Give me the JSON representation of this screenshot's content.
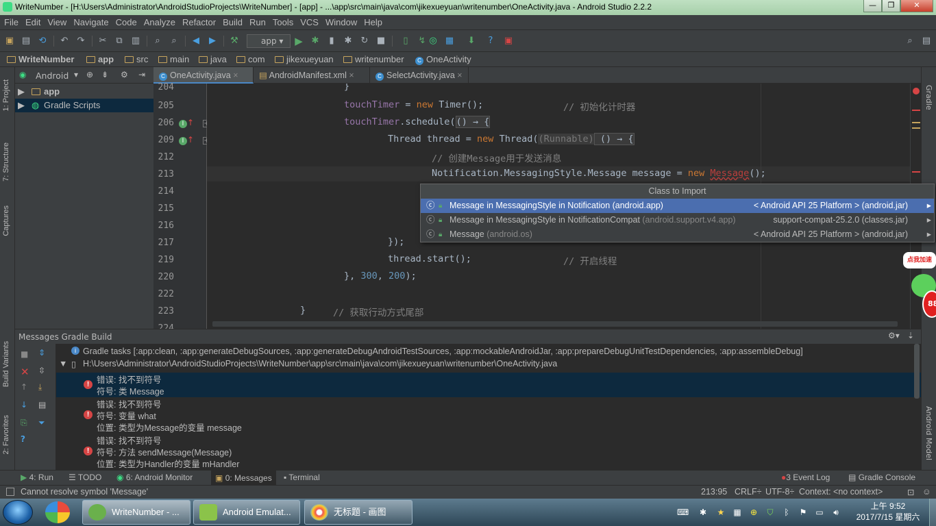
{
  "window": {
    "title": "WriteNumber - [H:\\Users\\Administrator\\AndroidStudioProjects\\WriteNumber] - [app] - ...\\app\\src\\main\\java\\com\\jikexueyuan\\writenumber\\OneActivity.java - Android Studio 2.2.2",
    "min": "—",
    "max": "❐",
    "close": "✕"
  },
  "menu": [
    "File",
    "Edit",
    "View",
    "Navigate",
    "Code",
    "Analyze",
    "Refactor",
    "Build",
    "Run",
    "Tools",
    "VCS",
    "Window",
    "Help"
  ],
  "toolbar": {
    "run_config": "app"
  },
  "breadcrumb": [
    "WriteNumber",
    "app",
    "src",
    "main",
    "java",
    "com",
    "jikexueyuan",
    "writenumber",
    "OneActivity"
  ],
  "left_tools": [
    "1: Project",
    "7: Structure",
    "Captures",
    "Build Variants",
    "2: Favorites"
  ],
  "right_tools": [
    "Gradle",
    "Android Model"
  ],
  "project_view": {
    "mode": "Android",
    "items": [
      {
        "label": "app",
        "selected": false
      },
      {
        "label": "Gradle Scripts",
        "selected": true
      }
    ]
  },
  "editor_tabs": [
    {
      "label": "OneActivity.java",
      "active": true
    },
    {
      "label": "AndroidManifest.xml",
      "active": false
    },
    {
      "label": "SelectActivity.java",
      "active": false
    }
  ],
  "line_numbers": [
    "204",
    "205",
    "206",
    "209",
    "212",
    "213",
    "214",
    "215",
    "216",
    "217",
    "219",
    "220",
    "222",
    "223",
    "224"
  ],
  "code": {
    "l205_a": "touchTimer",
    "l205_b": " = ",
    "l205_c": "new",
    "l205_d": " Timer();",
    "l205_cmt": "// 初始化计时器",
    "l206_a": "touchTimer",
    "l206_b": ".schedule(",
    "l206_c": "() → {",
    "l209_a": "Thread thread = ",
    "l209_b": "new",
    "l209_c": " Thread(",
    "l209_d": "(Runnable)",
    "l209_e": " () → {",
    "l212_cmt": "// 创建Message用于发送消息",
    "l213_a": "Notification.MessagingStyle.Message message = ",
    "l213_b": "new",
    "l213_c": "Message",
    "l213_d": "();",
    "l217": "});",
    "l219_a": "thread.start();",
    "l219_cmt": "// 开启线程",
    "l220_a": "}, ",
    "l220_b": "300",
    "l220_c": ", ",
    "l220_d": "200",
    "l220_e": ");",
    "l223_a": "}",
    "l223_cmt": "// 获取行动方式尾部"
  },
  "import_popup": {
    "title": "Class to Import",
    "items": [
      {
        "name": "Message in MessagingStyle in Notification (android.app)",
        "pkg": "",
        "loc": "< Android API 25 Platform > (android.jar)",
        "selected": true
      },
      {
        "name": "Message in MessagingStyle in NotificationCompat",
        "pkg": " (android.support.v4.app)",
        "loc": "support-compat-25.2.0 (classes.jar)",
        "selected": false
      },
      {
        "name": "Message",
        "pkg": " (android.os)",
        "loc": "< Android API 25 Platform > (android.jar)",
        "selected": false
      }
    ]
  },
  "messages": {
    "header": "Messages Gradle Build",
    "gradle_tasks": "Gradle tasks [:app:clean, :app:generateDebugSources, :app:generateDebugAndroidTestSources, :app:mockableAndroidJar, :app:prepareDebugUnitTestDependencies, :app:assembleDebug]",
    "file": "H:\\Users\\Administrator\\AndroidStudioProjects\\WriteNumber\\app\\src\\main\\java\\com\\jikexueyuan\\writenumber\\OneActivity.java",
    "errors": [
      {
        "l1": "错误: 找不到符号",
        "l2": "符号: 类 Message",
        "l3": ""
      },
      {
        "l1": "错误: 找不到符号",
        "l2": "符号:   变量 what",
        "l3": "位置: 类型为Message的变量 message"
      },
      {
        "l1": "错误: 找不到符号",
        "l2": "符号:   方法 sendMessage(Message)",
        "l3": "位置: 类型为Handler的变量 mHandler"
      }
    ]
  },
  "tool_tabs": {
    "run": "4: Run",
    "todo": "TODO",
    "monitor": "6: Android Monitor",
    "messages": "0: Messages",
    "terminal": "Terminal",
    "event_log": "3 Event Log",
    "gradle_console": "Gradle Console"
  },
  "status": {
    "message": "Cannot resolve symbol 'Message'",
    "position": "213:95",
    "line_sep": "CRLF÷",
    "encoding": "UTF-8÷",
    "context": "Context: <no context>"
  },
  "taskbar": {
    "apps": [
      "WriteNumber - ...",
      "Android Emulat...",
      "无标题 - 画图"
    ],
    "time": "上午 9:52",
    "date": "2017/7/15 星期六"
  },
  "overlay": {
    "badge": "点我加速",
    "percent": "88"
  }
}
